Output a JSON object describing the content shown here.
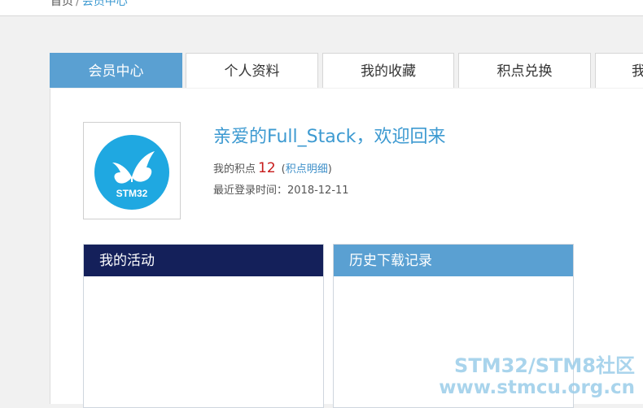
{
  "breadcrumb": {
    "home": "首页",
    "separator": "/",
    "current": "会员中心"
  },
  "tabs": [
    {
      "label": "会员中心",
      "active": true
    },
    {
      "label": "个人资料",
      "active": false
    },
    {
      "label": "我的收藏",
      "active": false
    },
    {
      "label": "积点兑换",
      "active": false
    },
    {
      "label": "我",
      "active": false
    }
  ],
  "profile": {
    "avatar_text": "STM32",
    "welcome": "亲爱的Full_Stack，欢迎回来",
    "points_label": "我的积点",
    "points_value": "12",
    "points_detail_link": "积点明细",
    "last_login_label": "最近登录时间：",
    "last_login_value": "2018-12-11"
  },
  "sections": {
    "activity_title": "我的活动",
    "download_history_title": "历史下载记录"
  },
  "watermark": {
    "line1": "STM32/STM8社区",
    "line2": "www.stmcu.org.cn"
  },
  "colors": {
    "accent": "#5aa0d2",
    "dark_header": "#14205a",
    "link": "#3d9ad1",
    "points": "#c71a1a"
  }
}
